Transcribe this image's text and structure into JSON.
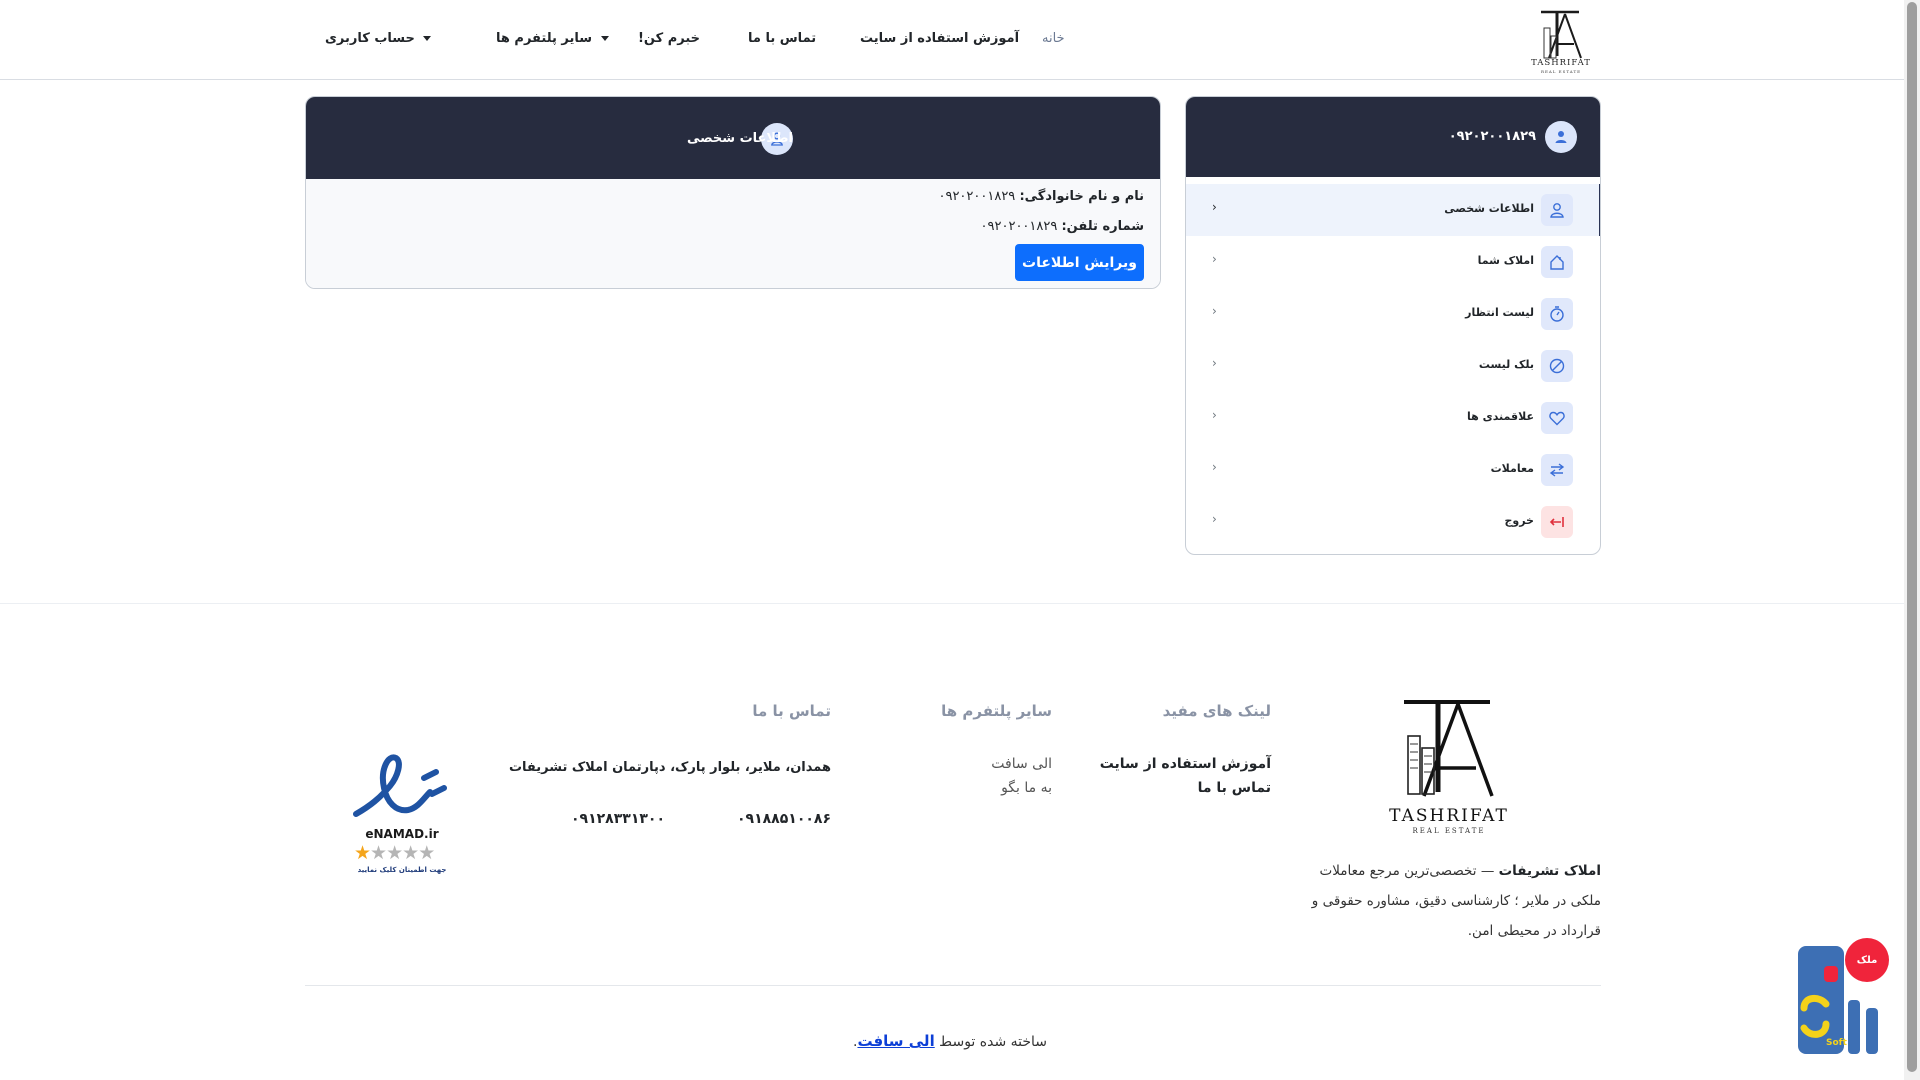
{
  "header": {
    "logo_text": "TASHRIFAT",
    "logo_sub": "REAL ESTATE",
    "nav": {
      "home": "خانه",
      "tutorial": "آموزش استفاده از سایت",
      "contact": "تماس با ما",
      "khabaram": "خبرم کن!",
      "platforms": "سایر پلتفرم ها",
      "account": "حساب کاربری"
    }
  },
  "sidebar": {
    "phone": "۰۹۲۰۲۰۰۱۸۲۹",
    "items": [
      {
        "label": "اطلاعات شخصی",
        "icon": "user-icon",
        "active": true
      },
      {
        "label": "املاک شما",
        "icon": "house-icon"
      },
      {
        "label": "لیست انتظار",
        "icon": "stopwatch-icon"
      },
      {
        "label": "بلک لیست",
        "icon": "block-icon"
      },
      {
        "label": "علاقمندی ها",
        "icon": "heart-icon"
      },
      {
        "label": "معاملات",
        "icon": "arrows-exchange-icon"
      },
      {
        "label": "خروج",
        "icon": "logout-icon",
        "danger": true
      }
    ]
  },
  "profile": {
    "title": "اطلاعات شخصی",
    "name_label": "نام و نام خانوادگی:",
    "name_value": "۰۹۲۰۲۰۰۱۸۲۹",
    "phone_label": "شماره تلفن:",
    "phone_value": "۰۹۲۰۲۰۰۱۸۲۹",
    "edit_button": "ویرایش اطلاعات"
  },
  "footer": {
    "logo_text": "TASHRIFAT",
    "logo_sub": "REAL ESTATE",
    "about_bold": "املاک تشریفات",
    "about_text": " — تخصصی‌ترین مرجع معاملات ملکی در ملایر ؛ کارشناسی دقیق، مشاوره حقوقی و قرارداد در محیطی امن.",
    "useful_links_title": "لینک های مفید",
    "useful_links": [
      "آموزش استفاده از سایت",
      "تماس با ما"
    ],
    "platforms_title": "سایر پلتفرم ها",
    "platforms": [
      "الی سافت",
      "به ما بگو"
    ],
    "contact_title": "تماس با ما",
    "address": "همدان، ملایر، بلوار پارک، دپارتمان املاک تشریفات",
    "phone1": "۰۹۱۸۸۵۱۰۰۸۶",
    "phone2": "۰۹۱۲۸۳۳۱۳۰۰",
    "enamad_label": "eNAMAD.ir",
    "enamad_caption": "جهت اطمینان کلیک نمایید",
    "built_by": "ساخته شده توسط",
    "built_link": "الی سافت",
    "built_dot": "."
  },
  "floating": {
    "badge_text": "ملک",
    "logo_text": "Soft"
  }
}
